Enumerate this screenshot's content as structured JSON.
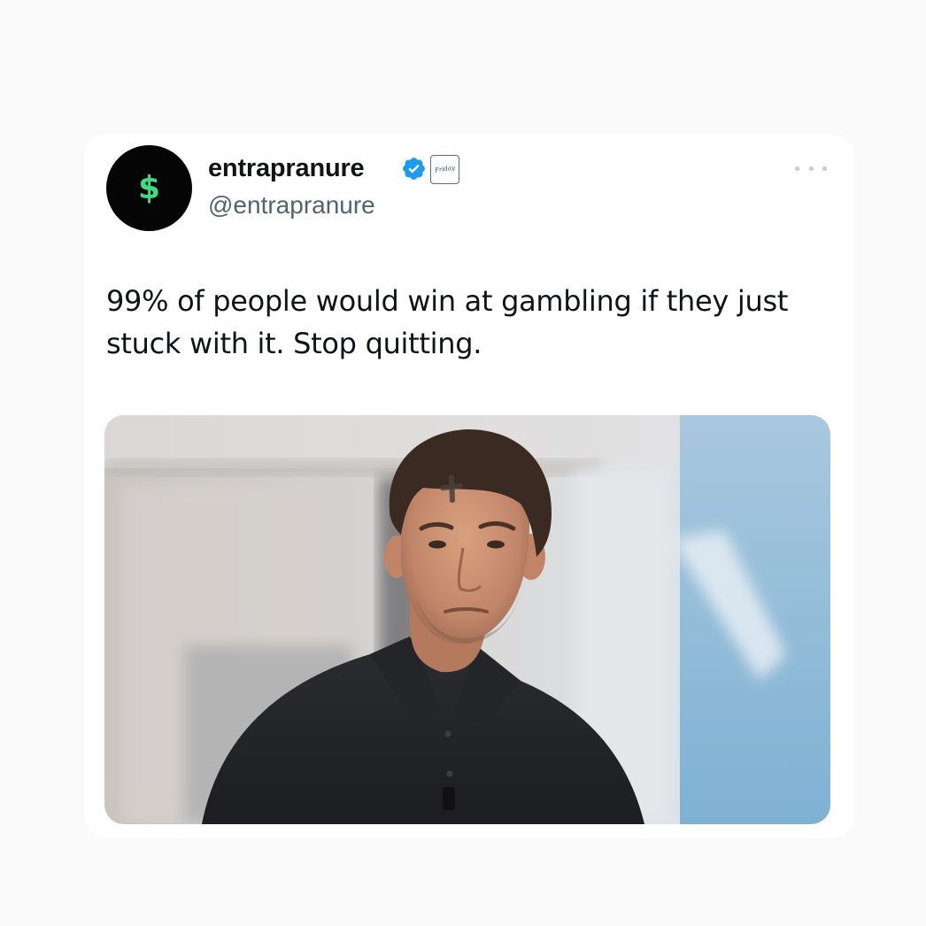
{
  "tweet": {
    "author": {
      "display_name": "entrapranure",
      "handle": "@entrapranure",
      "avatar_symbol": "$",
      "avatar_bg": "#050505",
      "avatar_symbol_color": "#3ddc84",
      "verified": true,
      "verified_color": "#1d9bf0",
      "affiliate_badge_text": "Friday"
    },
    "text": "99% of people would win at gambling if they just stuck with it. Stop quitting.",
    "media": {
      "type": "photo"
    },
    "more_options_icon": "more-horizontal-icon"
  },
  "colors": {
    "background": "#fafafa",
    "card": "#ffffff",
    "text_primary": "#0f1419",
    "text_secondary": "#536471"
  }
}
